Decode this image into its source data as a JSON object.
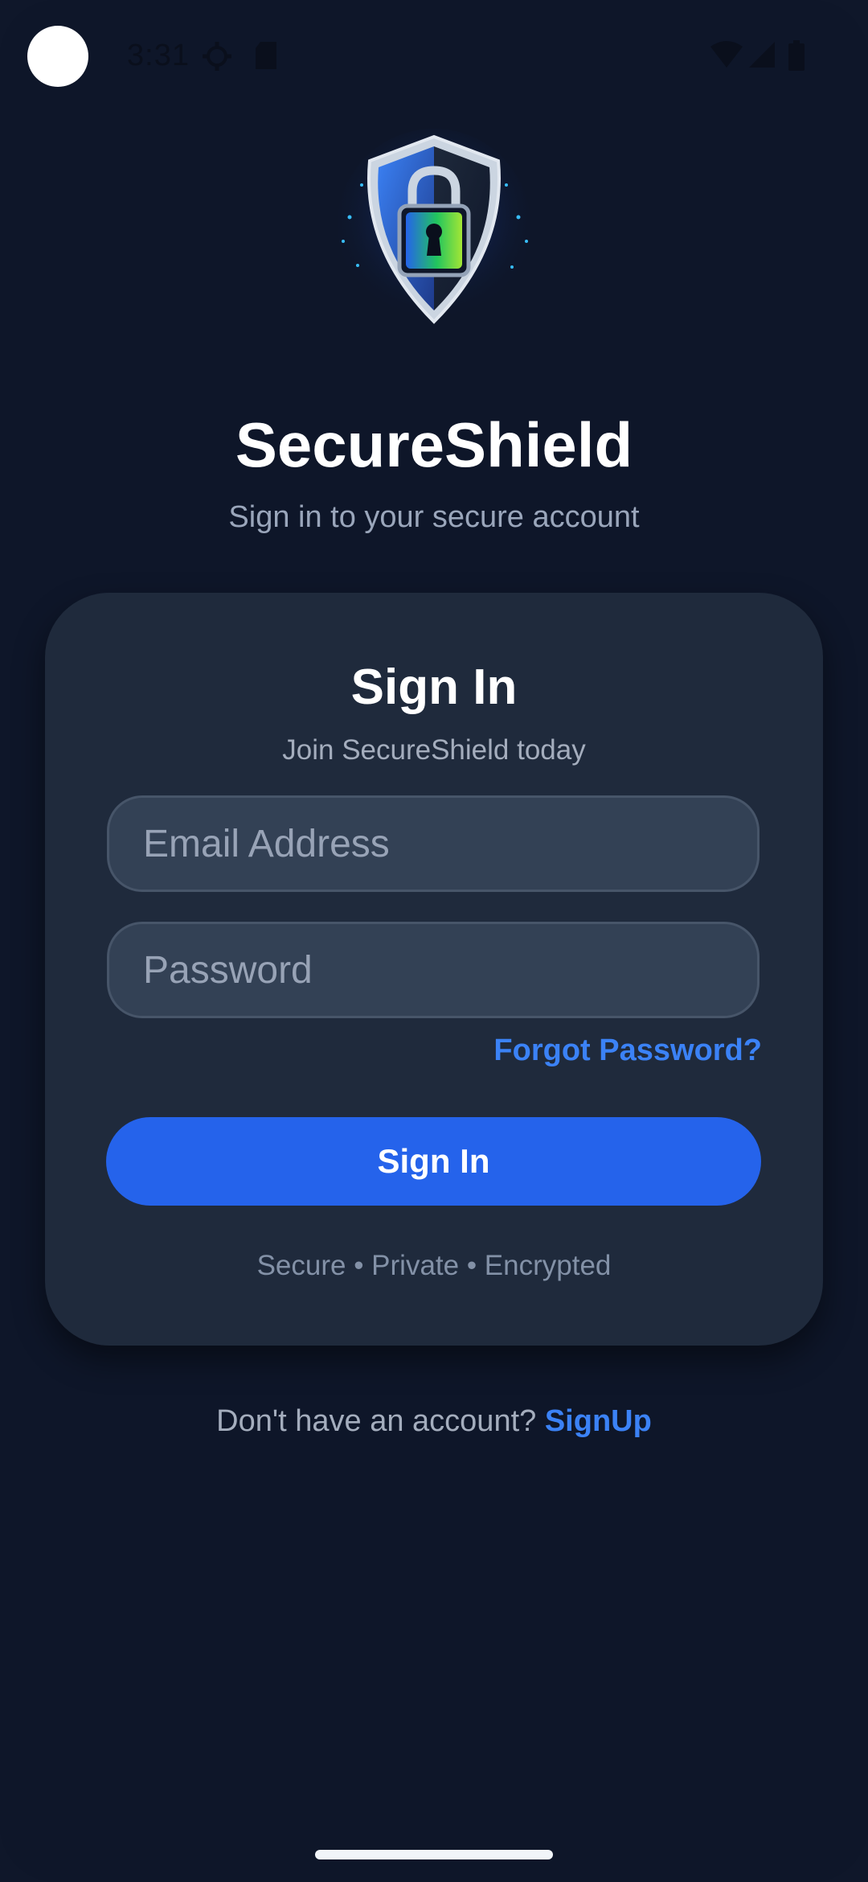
{
  "status_bar": {
    "time": "3:31",
    "icons": [
      "gear-icon",
      "sd-card-icon",
      "wifi-icon",
      "signal-icon",
      "battery-icon"
    ]
  },
  "header": {
    "app_name": "SecureShield",
    "subtitle": "Sign in to your secure account",
    "logo_icon": "shield-lock-icon"
  },
  "card": {
    "title": "Sign In",
    "subtitle": "Join SecureShield today",
    "email_placeholder": "Email Address",
    "password_placeholder": "Password",
    "forgot_password": "Forgot Password?",
    "signin_button": "Sign In",
    "tagline": "Secure • Private • Encrypted"
  },
  "footer": {
    "prompt": "Don't have an account?",
    "signup_link": "SignUp"
  },
  "colors": {
    "background": "#0e1629",
    "card": "#1f2a3c",
    "accent": "#2563eb",
    "link": "#3b82f6"
  }
}
